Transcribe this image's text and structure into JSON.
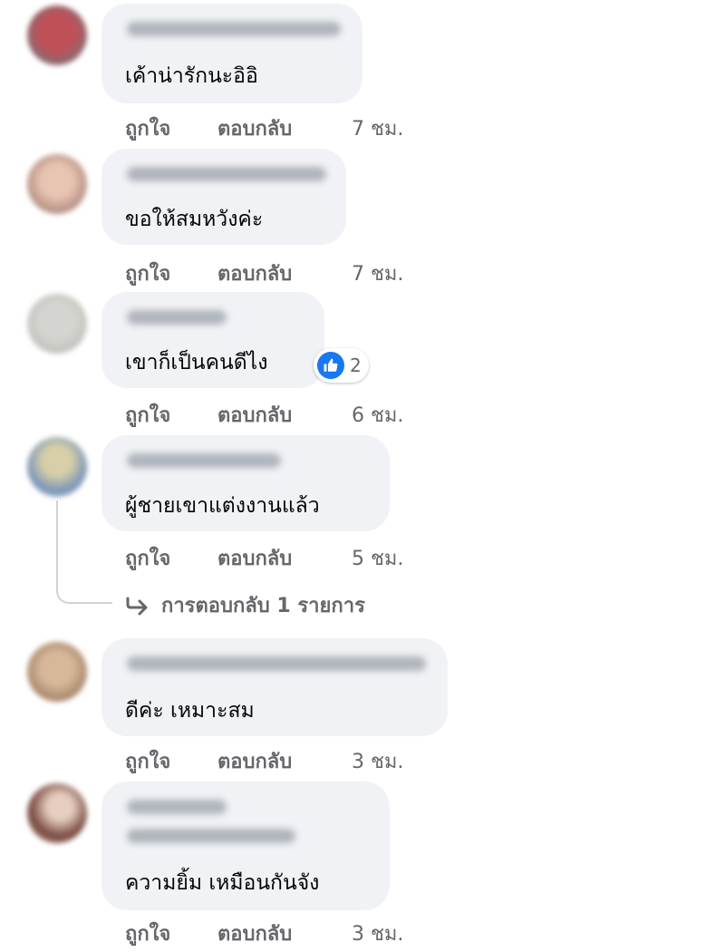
{
  "comments": [
    {
      "text": "เค้าน่ารักนะอิอิ",
      "like_label": "ถูกใจ",
      "reply_label": "ตอบกลับ",
      "time": "7 ชม.",
      "avatar_color": "#b04a52"
    },
    {
      "text": "ขอให้สมหวังค่ะ",
      "like_label": "ถูกใจ",
      "reply_label": "ตอบกลับ",
      "time": "7 ชม.",
      "avatar_color": "#c9a89b"
    },
    {
      "text": "เขาก็เป็นคนดีไง",
      "like_label": "ถูกใจ",
      "reply_label": "ตอบกลับ",
      "time": "6 ชม.",
      "avatar_color": "#c8c8c4",
      "reaction_count": "2"
    },
    {
      "text": "ผู้ชายเขาแต่งงานแล้ว",
      "like_label": "ถูกใจ",
      "reply_label": "ตอบกลับ",
      "time": "5 ชม.",
      "avatar_color": "#7f97b5",
      "replies_label": "การตอบกลับ 1 รายการ"
    },
    {
      "text": "ดีค่ะ เหมาะสม",
      "like_label": "ถูกใจ",
      "reply_label": "ตอบกลับ",
      "time": "3 ชม.",
      "avatar_color": "#b08a6c"
    },
    {
      "text": "ความยิ้ม เหมือนกันจัง",
      "like_label": "ถูกใจ",
      "reply_label": "ตอบกลับ",
      "time": "3 ชม.",
      "avatar_color": "#8a5a50"
    }
  ],
  "colors": {
    "bubble": "#f0f2f5",
    "meta_text": "#65676b",
    "like_blue": "#1877f2"
  },
  "icons": {
    "reaction": "thumbs-up-icon",
    "reply_arrow": "reply-arrow-icon"
  }
}
